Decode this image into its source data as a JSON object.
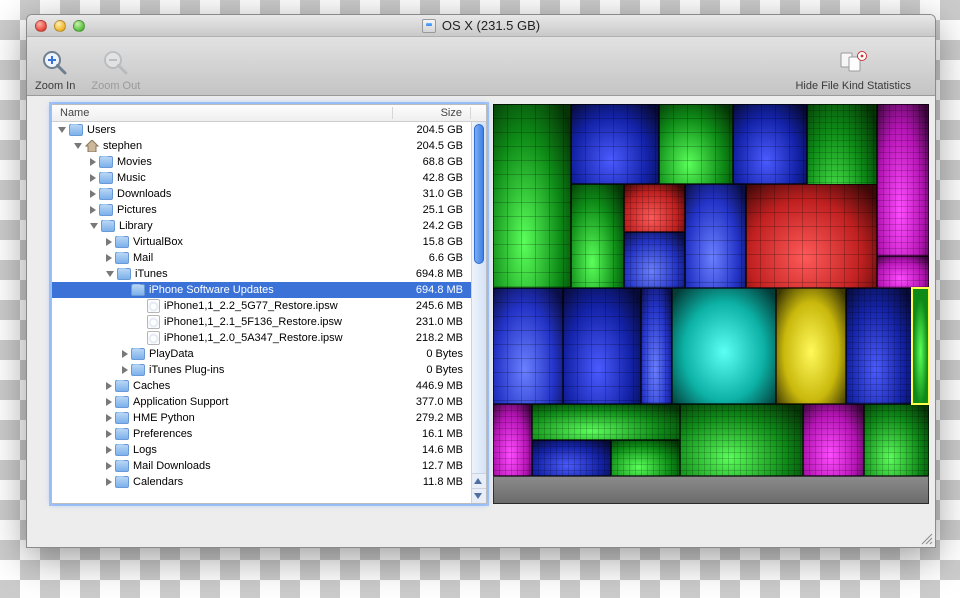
{
  "window": {
    "title": "OS X (231.5 GB)"
  },
  "toolbar": {
    "zoom_in_label": "Zoom In",
    "zoom_out_label": "Zoom Out",
    "hide_stats_label": "Hide File Kind Statistics"
  },
  "columns": {
    "name": "Name",
    "size": "Size"
  },
  "rows": [
    {
      "indent": 0,
      "disclosure": "down",
      "icon": "folder",
      "name": "Users",
      "size": "204.5 GB"
    },
    {
      "indent": 1,
      "disclosure": "down",
      "icon": "home",
      "name": "stephen",
      "size": "204.5 GB"
    },
    {
      "indent": 2,
      "disclosure": "right",
      "icon": "folder",
      "name": "Movies",
      "size": "68.8 GB"
    },
    {
      "indent": 2,
      "disclosure": "right",
      "icon": "folder",
      "name": "Music",
      "size": "42.8 GB"
    },
    {
      "indent": 2,
      "disclosure": "right",
      "icon": "folder",
      "name": "Downloads",
      "size": "31.0 GB"
    },
    {
      "indent": 2,
      "disclosure": "right",
      "icon": "folder",
      "name": "Pictures",
      "size": "25.1 GB"
    },
    {
      "indent": 2,
      "disclosure": "down",
      "icon": "folder",
      "name": "Library",
      "size": "24.2 GB"
    },
    {
      "indent": 3,
      "disclosure": "right",
      "icon": "folder",
      "name": "VirtualBox",
      "size": "15.8 GB"
    },
    {
      "indent": 3,
      "disclosure": "right",
      "icon": "folder",
      "name": "Mail",
      "size": "6.6 GB"
    },
    {
      "indent": 3,
      "disclosure": "down",
      "icon": "folder",
      "name": "iTunes",
      "size": "694.8 MB"
    },
    {
      "indent": 4,
      "disclosure": "none",
      "icon": "folder",
      "name": "iPhone Software Updates",
      "size": "694.8 MB",
      "selected": true
    },
    {
      "indent": 5,
      "disclosure": "none",
      "icon": "file",
      "name": "iPhone1,1_2.2_5G77_Restore.ipsw",
      "size": "245.6 MB"
    },
    {
      "indent": 5,
      "disclosure": "none",
      "icon": "file",
      "name": "iPhone1,1_2.1_5F136_Restore.ipsw",
      "size": "231.0 MB"
    },
    {
      "indent": 5,
      "disclosure": "none",
      "icon": "file",
      "name": "iPhone1,1_2.0_5A347_Restore.ipsw",
      "size": "218.2 MB"
    },
    {
      "indent": 4,
      "disclosure": "right",
      "icon": "folder",
      "name": "PlayData",
      "size": "0 Bytes"
    },
    {
      "indent": 4,
      "disclosure": "right",
      "icon": "folder",
      "name": "iTunes Plug-ins",
      "size": "0 Bytes"
    },
    {
      "indent": 3,
      "disclosure": "right",
      "icon": "folder",
      "name": "Caches",
      "size": "446.9 MB"
    },
    {
      "indent": 3,
      "disclosure": "right",
      "icon": "folder",
      "name": "Application Support",
      "size": "377.0 MB"
    },
    {
      "indent": 3,
      "disclosure": "right",
      "icon": "folder",
      "name": "HME Python",
      "size": "279.2 MB"
    },
    {
      "indent": 3,
      "disclosure": "right",
      "icon": "folder",
      "name": "Preferences",
      "size": "16.1 MB"
    },
    {
      "indent": 3,
      "disclosure": "right",
      "icon": "folder",
      "name": "Logs",
      "size": "14.6 MB"
    },
    {
      "indent": 3,
      "disclosure": "right",
      "icon": "folder",
      "name": "Mail Downloads",
      "size": "12.7 MB"
    },
    {
      "indent": 3,
      "disclosure": "right",
      "icon": "folder",
      "name": "Calendars",
      "size": "11.8 MB"
    }
  ]
}
